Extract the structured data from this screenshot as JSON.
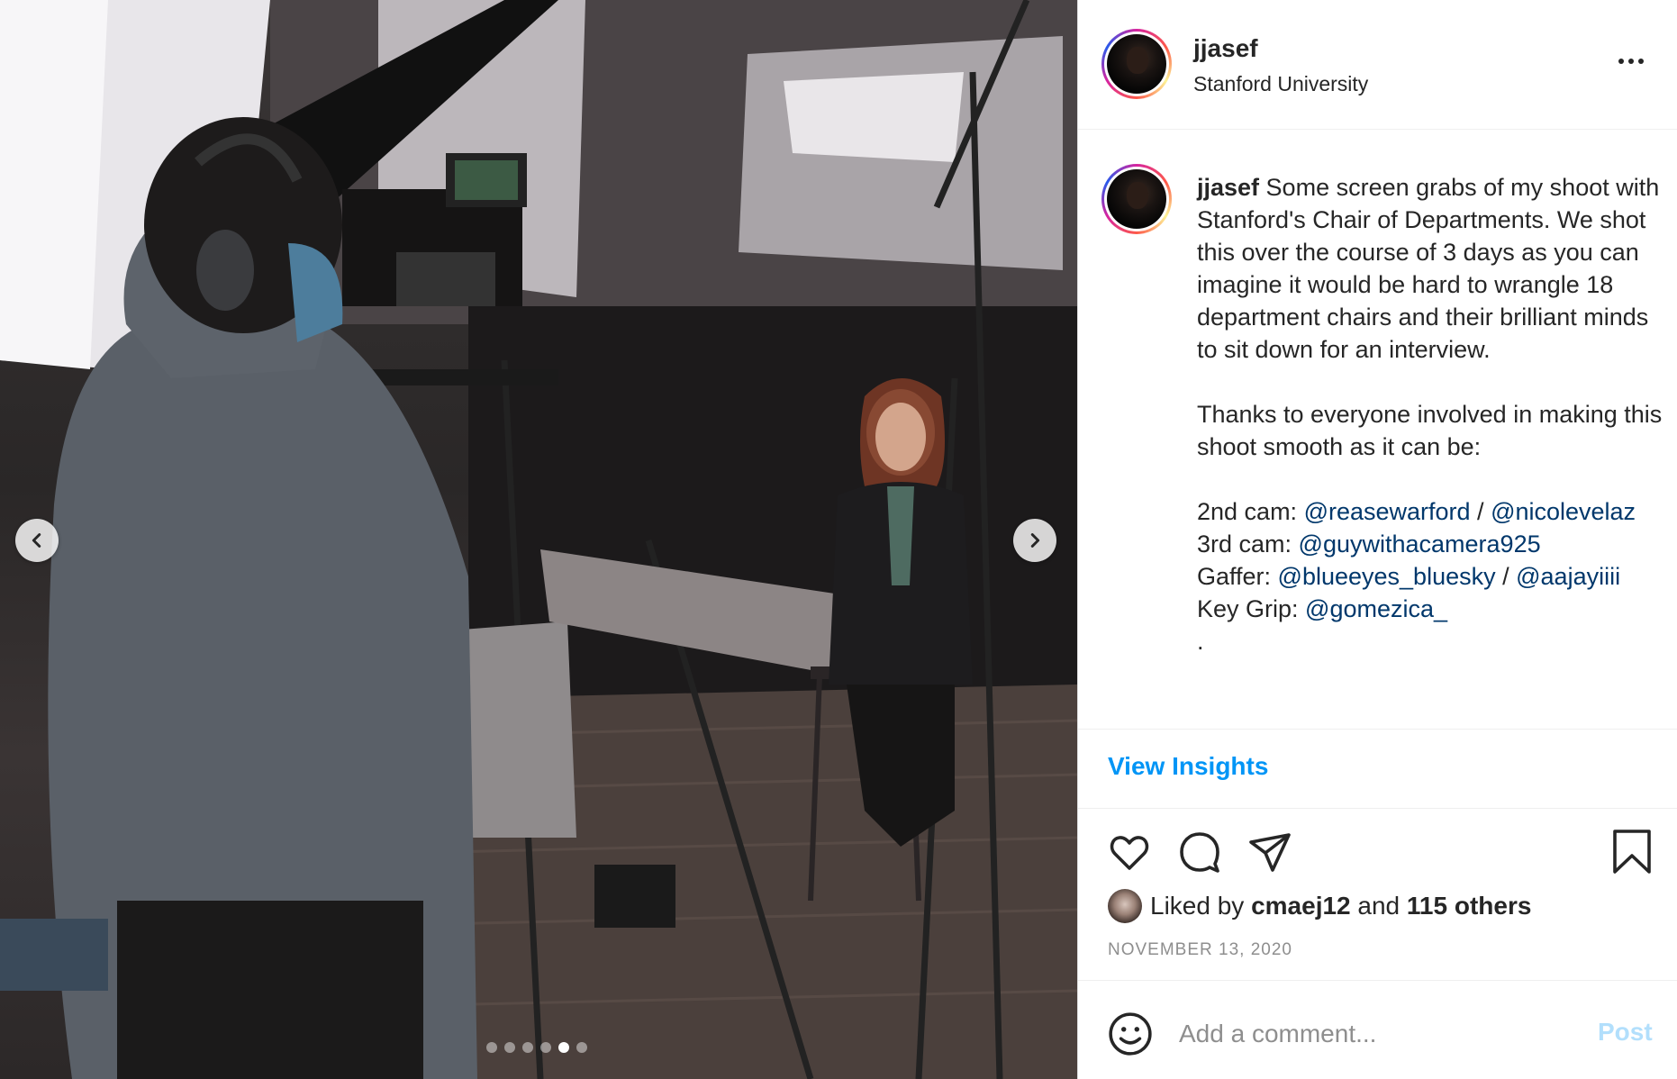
{
  "post": {
    "username": "jjasef",
    "location": "Stanford University"
  },
  "media": {
    "slide_count": 6,
    "active_slide": 5,
    "prev_icon": "chevron-left-icon",
    "next_icon": "chevron-right-icon"
  },
  "caption": {
    "username": "jjasef",
    "intro": " Some screen grabs of my shoot with Stanford's Chair of Departments. We shot this over the course of 3 days as you can imagine it would be hard to wrangle 18 department chairs and their brilliant minds to sit down for an interview.",
    "thanks": "Thanks to everyone involved in making this shoot smooth as it can be:",
    "credit1_label": "2nd cam: ",
    "credit1_m1": "@reasewarford",
    "credit1_sep": " / ",
    "credit1_m2": "@nicolevelaz",
    "credit2_label": "3rd cam: ",
    "credit2_m1": "@guywithacamera925",
    "credit3_label": "Gaffer: ",
    "credit3_m1": "@blueeyes_bluesky",
    "credit3_sep": " / ",
    "credit3_m2": "@aajayiiii",
    "credit4_label": "Key Grip: ",
    "credit4_m1": "@gomezica_",
    "dot": "."
  },
  "insights_label": "View Insights",
  "likes": {
    "prefix": "Liked by ",
    "user": "cmaej12",
    "middle": " and ",
    "others": "115 others"
  },
  "date": "NOVEMBER 13, 2020",
  "comment": {
    "placeholder": "Add a comment...",
    "post_label": "Post"
  },
  "colors": {
    "link": "#0095f6",
    "mention": "#00376b",
    "muted": "#8e8e8e"
  }
}
